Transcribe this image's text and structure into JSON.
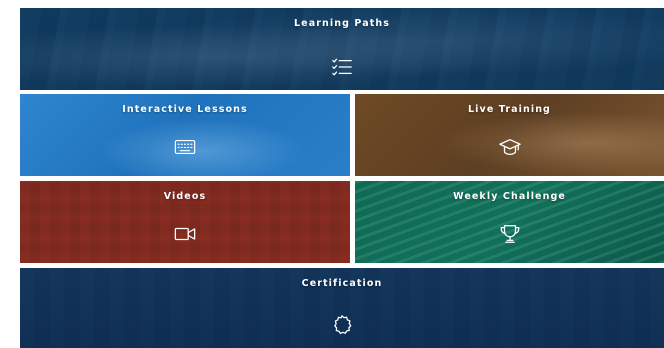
{
  "tiles": {
    "learning_paths": {
      "label": "Learning Paths",
      "icon": "checklist-icon"
    },
    "interactive_lessons": {
      "label": "Interactive Lessons",
      "icon": "keyboard-icon"
    },
    "live_training": {
      "label": "Live Training",
      "icon": "graduation-cap-icon"
    },
    "videos": {
      "label": "Videos",
      "icon": "video-camera-icon"
    },
    "weekly_challenge": {
      "label": "Weekly Challenge",
      "icon": "trophy-icon"
    },
    "certification": {
      "label": "Certification",
      "icon": "badge-icon"
    }
  },
  "colors": {
    "learning_paths": "#15406a",
    "interactive_lessons": "#2a7fc8",
    "live_training": "#6a4626",
    "videos": "#8f3a2c",
    "weekly_challenge": "#10674f",
    "certification": "#14325a",
    "label": "#ffffff"
  }
}
